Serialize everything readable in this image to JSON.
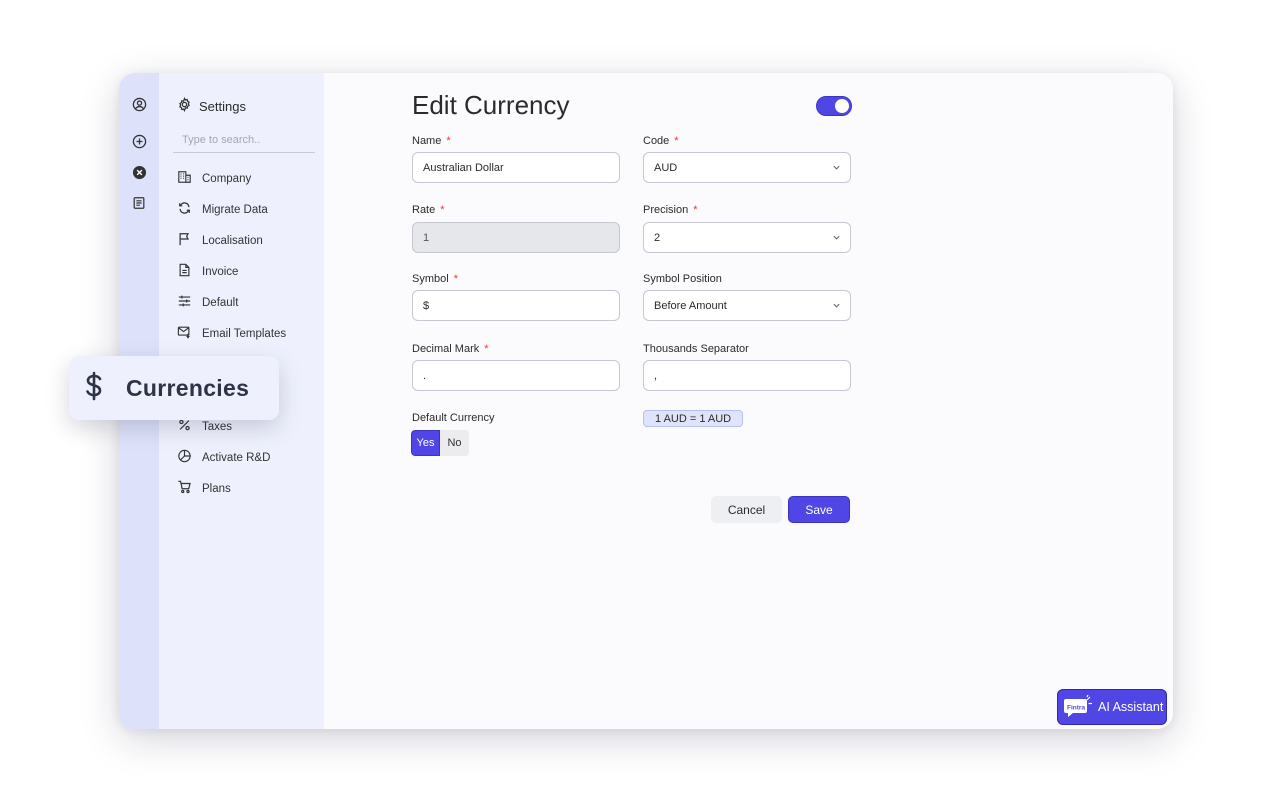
{
  "sidebar": {
    "title": "Settings",
    "search_placeholder": "Type to search..",
    "items": [
      {
        "label": "Company",
        "icon": "building-icon"
      },
      {
        "label": "Migrate Data",
        "icon": "sync-icon"
      },
      {
        "label": "Localisation",
        "icon": "flag-icon"
      },
      {
        "label": "Invoice",
        "icon": "document-icon"
      },
      {
        "label": "Default",
        "icon": "sliders-icon"
      },
      {
        "label": "Email Templates",
        "icon": "mail-icon"
      },
      {
        "label": "Taxes",
        "icon": "percent-icon"
      },
      {
        "label": "Activate R&D",
        "icon": "chart-icon"
      },
      {
        "label": "Plans",
        "icon": "cart-icon"
      }
    ]
  },
  "floating_highlight": {
    "label": "Currencies",
    "icon": "dollar-icon"
  },
  "form": {
    "title": "Edit Currency",
    "enabled": true,
    "name": {
      "label": "Name",
      "value": "Australian Dollar"
    },
    "code": {
      "label": "Code",
      "value": "AUD"
    },
    "rate": {
      "label": "Rate",
      "value": "1"
    },
    "precision": {
      "label": "Precision",
      "value": "2"
    },
    "symbol": {
      "label": "Symbol",
      "value": "$"
    },
    "symbol_position": {
      "label": "Symbol Position",
      "value": "Before Amount"
    },
    "decimal_mark": {
      "label": "Decimal Mark",
      "value": "."
    },
    "thousands_separator": {
      "label": "Thousands Separator",
      "value": ","
    },
    "default_currency": {
      "label": "Default Currency",
      "yes": "Yes",
      "no": "No",
      "selected": "Yes"
    },
    "rate_badge": "1 AUD = 1 AUD",
    "required_mark": "*"
  },
  "actions": {
    "cancel": "Cancel",
    "save": "Save"
  },
  "ai_assistant": {
    "label": "AI Assistant",
    "logo_text": "Fintra"
  },
  "colors": {
    "accent": "#4f46e5",
    "rail": "#dde2fa",
    "panel": "#eef1fd"
  }
}
